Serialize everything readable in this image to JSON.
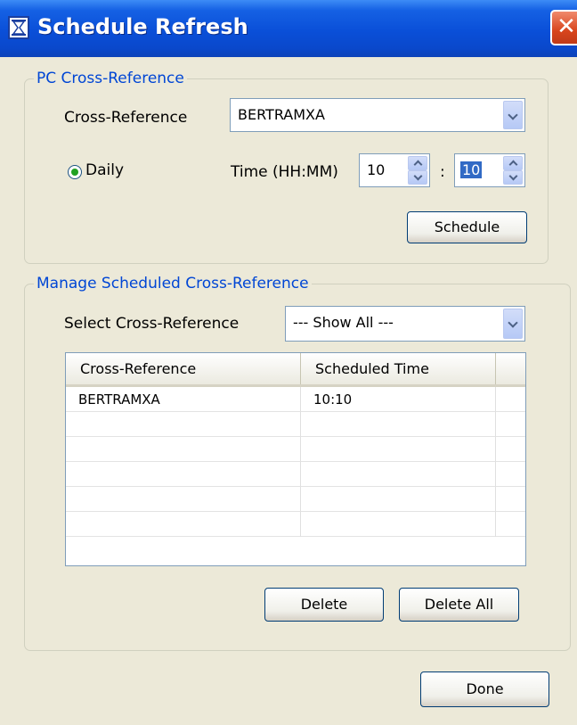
{
  "window": {
    "title": "Schedule Refresh",
    "close_glyph": "✕"
  },
  "pc_section": {
    "legend": "PC Cross-Reference",
    "xref_label": "Cross-Reference",
    "xref_value": "BERTRAMXA",
    "daily_label": "Daily",
    "daily_selected": true,
    "time_label": "Time (HH:MM)",
    "hour_value": "10",
    "colon": ":",
    "minute_value": "10",
    "schedule_button": "Schedule"
  },
  "manage_section": {
    "legend": "Manage Scheduled Cross-Reference",
    "select_label": "Select Cross-Reference",
    "select_value": "--- Show All ---",
    "table": {
      "columns": [
        "Cross-Reference",
        "Scheduled Time"
      ],
      "rows": [
        [
          "BERTRAMXA",
          "10:10"
        ],
        [
          "",
          ""
        ],
        [
          "",
          ""
        ],
        [
          "",
          ""
        ],
        [
          "",
          ""
        ],
        [
          "",
          ""
        ]
      ]
    },
    "delete_button": "Delete",
    "delete_all_button": "Delete All"
  },
  "done_button": "Done"
}
